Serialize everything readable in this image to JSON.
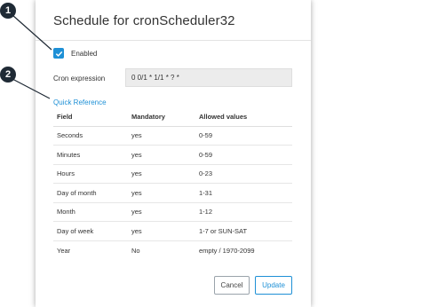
{
  "dialog": {
    "title": "Schedule for cronScheduler32"
  },
  "enabled": {
    "label": "Enabled",
    "checked": true
  },
  "cron": {
    "label": "Cron expression",
    "value": "0 0/1 * 1/1 * ? *"
  },
  "quick_reference": {
    "link_text": "Quick Reference",
    "headers": [
      "Field",
      "Mandatory",
      "Allowed values"
    ],
    "rows": [
      [
        "Seconds",
        "yes",
        "0-59"
      ],
      [
        "Minutes",
        "yes",
        "0-59"
      ],
      [
        "Hours",
        "yes",
        "0-23"
      ],
      [
        "Day of month",
        "yes",
        "1-31"
      ],
      [
        "Month",
        "yes",
        "1-12"
      ],
      [
        "Day of week",
        "yes",
        "1-7 or SUN-SAT"
      ],
      [
        "Year",
        "No",
        "empty / 1970-2099"
      ]
    ]
  },
  "buttons": {
    "cancel": "Cancel",
    "update": "Update"
  },
  "callouts": {
    "one": "1",
    "two": "2"
  },
  "colors": {
    "accent": "#1e90d6",
    "callout": "#1f2a35"
  }
}
